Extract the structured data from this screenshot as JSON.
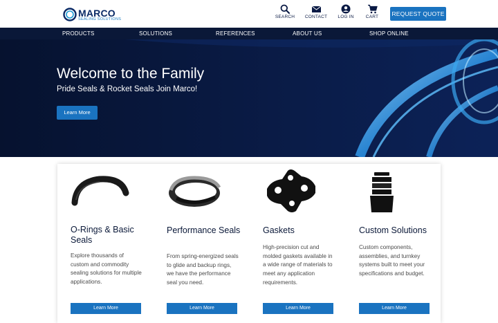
{
  "brand": {
    "name": "MARCO",
    "tagline": "SEALING SOLUTIONS"
  },
  "utility": [
    {
      "label": "SEARCH",
      "icon": "search-icon"
    },
    {
      "label": "CONTACT",
      "icon": "envelope-icon"
    },
    {
      "label": "LOG IN",
      "icon": "user-icon"
    },
    {
      "label": "CART",
      "icon": "cart-icon"
    }
  ],
  "quote_label": "REQUEST QUOTE",
  "nav": [
    "PRODUCTS",
    "SOLUTIONS",
    "REFERENCES",
    "ABOUT US",
    "SHOP ONLINE"
  ],
  "hero": {
    "title": "Welcome to the Family",
    "subtitle": "Pride Seals & Rocket Seals Join Marco!",
    "button": "Learn More"
  },
  "products": [
    {
      "title": "O-Rings & Basic Seals",
      "description": "Explore thousands of custom and commodity sealing solutions for multiple applications.",
      "button": "Learn More"
    },
    {
      "title": "Performance Seals",
      "description": "From spring-energized seals to glide and backup rings, we have the performance seal you need.",
      "button": "Learn More"
    },
    {
      "title": "Gaskets",
      "description": "High-precision cut and molded gaskets available in a wide range of materials to meet any application requirements.",
      "button": "Learn More"
    },
    {
      "title": "Custom Solutions",
      "description": "Custom components, assemblies, and turnkey systems built to meet your specifications and budget.",
      "button": "Learn More"
    }
  ],
  "colors": {
    "navy": "#0a1838",
    "accent_blue": "#1a73c0",
    "hero_bg": "#05102e"
  }
}
